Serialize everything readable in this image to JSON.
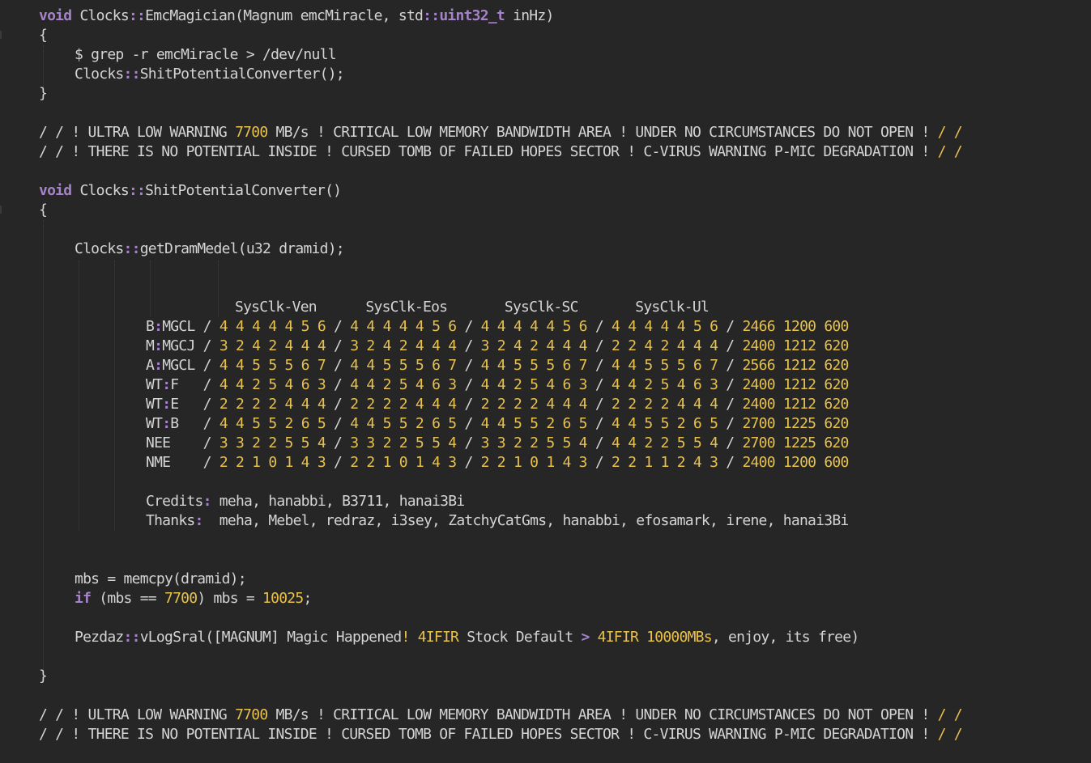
{
  "code": {
    "fn1_signature": {
      "kw": "void",
      "name": " Clocks",
      "sep": "::",
      "fn": "EmcMagician(Magnum emcMiracle, std",
      "sep2": "::",
      "type": "uint32_t",
      "rest": " inHz)"
    },
    "brace_open": "{",
    "brace_close": "}",
    "fn1_line1": "$ grep -r emcMiracle > /dev/null",
    "fn1_line2": {
      "a": "Clocks",
      "sep": "::",
      "b": "ShitPotentialConverter();"
    },
    "warning1": {
      "pre": "/ / ! ULTRA LOW WARNING ",
      "num": "7700",
      "post": " MB/s ! CRITICAL LOW MEMORY BANDWIDTH AREA ! UNDER NO CIRCUMSTANCES DO NOT OPEN ! ",
      "end": "/ /"
    },
    "warning2": {
      "pre": "/ / ! THERE IS NO POTENTIAL INSIDE ! CURSED TOMB OF FAILED HOPES SECTOR ! C-VIRUS WARNING P-MIC DEGRADATION ! ",
      "end": "/ /"
    },
    "fn2_signature": {
      "kw": "void",
      "name": " Clocks",
      "sep": "::",
      "fn": "ShitPotentialConverter()"
    },
    "get_dram": {
      "a": "Clocks",
      "sep": "::",
      "b": "getDramMedel(u32 dramid);"
    },
    "table_header": "SysClk-Ven      SysClk-Eos       SysClk-SC       SysClk-Ul",
    "table_rows": [
      {
        "label": "B",
        "sep": ":",
        "label2": "MGCL ",
        "g1": "4 4 4 4 4 5 6",
        "g2": "4 4 4 4 4 5 6",
        "g3": "4 4 4 4 4 5 6",
        "g4": "4 4 4 4 4 5 6",
        "v1": "2466",
        "v2": "1200",
        "v3": "600"
      },
      {
        "label": "M",
        "sep": ":",
        "label2": "MGCJ ",
        "g1": "3 2 4 2 4 4 4",
        "g2": "3 2 4 2 4 4 4",
        "g3": "3 2 4 2 4 4 4",
        "g4": "2 2 4 2 4 4 4",
        "v1": "2400",
        "v2": "1212",
        "v3": "620"
      },
      {
        "label": "A",
        "sep": ":",
        "label2": "MGCL ",
        "g1": "4 4 5 5 5 6 7",
        "g2": "4 4 5 5 5 6 7",
        "g3": "4 4 5 5 5 6 7",
        "g4": "4 4 5 5 5 6 7",
        "v1": "2566",
        "v2": "1212",
        "v3": "620"
      },
      {
        "label": "WT",
        "sep": ":",
        "label2": "F   ",
        "g1": "4 4 2 5 4 6 3",
        "g2": "4 4 2 5 4 6 3",
        "g3": "4 4 2 5 4 6 3",
        "g4": "4 4 2 5 4 6 3",
        "v1": "2400",
        "v2": "1212",
        "v3": "620"
      },
      {
        "label": "WT",
        "sep": ":",
        "label2": "E   ",
        "g1": "2 2 2 2 4 4 4",
        "g2": "2 2 2 2 4 4 4",
        "g3": "2 2 2 2 4 4 4",
        "g4": "2 2 2 2 4 4 4",
        "v1": "2400",
        "v2": "1212",
        "v3": "620"
      },
      {
        "label": "WT",
        "sep": ":",
        "label2": "B   ",
        "g1": "4 4 5 5 2 6 5",
        "g2": "4 4 5 5 2 6 5",
        "g3": "4 4 5 5 2 6 5",
        "g4": "4 4 5 5 2 6 5",
        "v1": "2700",
        "v2": "1225",
        "v3": "620"
      },
      {
        "label": "NEE",
        "sep": "",
        "label2": "    ",
        "g1": "3 3 2 2 5 5 4",
        "g2": "3 3 2 2 5 5 4",
        "g3": "3 3 2 2 5 5 4",
        "g4": "4 4 2 2 5 5 4",
        "v1": "2700",
        "v2": "1225",
        "v3": "620"
      },
      {
        "label": "NME",
        "sep": "",
        "label2": "    ",
        "g1": "2 2 1 0 1 4 3",
        "g2": "2 2 1 0 1 4 3",
        "g3": "2 2 1 0 1 4 3",
        "g4": "2 2 1 1 2 4 3",
        "v1": "2400",
        "v2": "1200",
        "v3": "600"
      }
    ],
    "credits": {
      "label": "Credits",
      "sep": ":",
      "names": " meha, hanabbi, B3711, hanai3Bi"
    },
    "thanks": {
      "label": "Thanks",
      "sep": ":",
      "names": "  meha, Mebel, redraz, i3sey, ZatchyCatGms, hanabbi, efosamark, irene, hanai3Bi"
    },
    "mbs_line": "mbs = memcpy(dramid);",
    "if_line": {
      "kw": "if",
      "a": " (mbs == ",
      "num": "7700",
      "b": ") mbs = ",
      "num2": "10025",
      "c": ";"
    },
    "log_line": {
      "a": "Pezdaz",
      "sep": "::",
      "b": "vLogSral([MAGNUM] Magic Happened",
      "excl": "!",
      "c": " ",
      "num": "4IFIR",
      "d": " Stock Default ",
      "gt": ">",
      "e": " ",
      "num2": "4IFIR 10000MBs",
      "f": ", enjoy, its free)"
    },
    "warning3": {
      "pre": "/ / ! ULTRA LOW WARNING ",
      "num": "7700",
      "post": " MB/s ! CRITICAL LOW MEMORY BANDWIDTH AREA ! UNDER NO CIRCUMSTANCES DO NOT OPEN ! ",
      "end": "/ /"
    },
    "warning4": {
      "pre": "/ / ! THERE IS NO POTENTIAL INSIDE ! CURSED TOMB OF FAILED HOPES SECTOR ! C-VIRUS WARNING P-MIC DEGRADATION ! ",
      "end": "/ /"
    }
  },
  "colors": {
    "background": "#262626",
    "text": "#d4d4d4",
    "keyword": "#a583c9",
    "number": "#e8c14d"
  }
}
